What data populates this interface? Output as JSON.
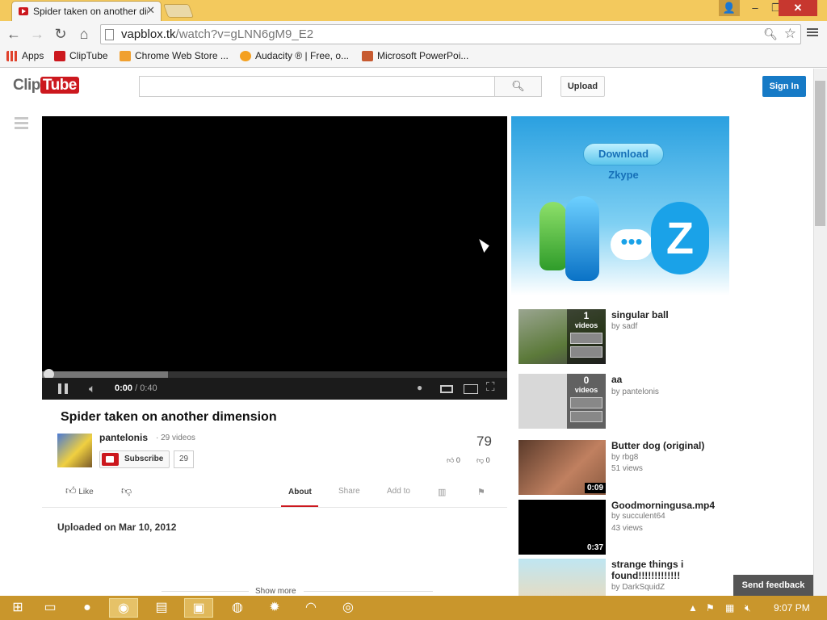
{
  "browser": {
    "tab_title": "Spider taken on another dimension",
    "tab_close": "✕",
    "url_domain": "vapblox.tk",
    "url_path": "/watch?v=gLNN6gM9_E2",
    "bookmarks": [
      {
        "label": "Apps",
        "color": "#e0412b"
      },
      {
        "label": "ClipTube",
        "color": "#cc181e"
      },
      {
        "label": "Chrome Web Store ...",
        "color": "#f0a030"
      },
      {
        "label": "Audacity ® | Free, o...",
        "color": "#f4a020"
      },
      {
        "label": "Microsoft PowerPoi...",
        "color": "#c75a30"
      }
    ],
    "window_buttons": {
      "minimize": "‒",
      "restore": "❐",
      "close": "✕"
    }
  },
  "site": {
    "logo_clip": "Clip",
    "logo_tube": "Tube",
    "upload_label": "Upload",
    "signin_label": "Sign In",
    "search_placeholder": ""
  },
  "player": {
    "current_time": "0:00",
    "duration": "/ 0:40",
    "buffered_fraction": 0.27
  },
  "video": {
    "title": "Spider taken on another dimension",
    "uploader": "pantelonis",
    "video_count": "· 29 videos",
    "subscribe_label": "Subscribe",
    "subscriber_count": "29",
    "views": "79",
    "likes": "0",
    "dislikes": "0",
    "like_label": "Like",
    "tabs": {
      "about": "About",
      "share": "Share",
      "add_to": "Add to"
    },
    "uploaded": "Uploaded on Mar 10, 2012",
    "show_more": "Show more"
  },
  "ad": {
    "button": "Download Zkype",
    "letter": "Z",
    "dots": "•••"
  },
  "related": [
    {
      "title": "singular ball",
      "by": "by sadf",
      "views": "",
      "duration": "",
      "playlist_count": "1",
      "playlist_label": "videos"
    },
    {
      "title": "aa",
      "by": "by pantelonis",
      "views": "",
      "duration": "",
      "playlist_count": "0",
      "playlist_label": "videos"
    },
    {
      "title": "Butter dog (original)",
      "by": "by rbg8",
      "views": "51 views",
      "duration": "0:09"
    },
    {
      "title": "Goodmorningusa.mp4",
      "by": "by succulent64",
      "views": "43 views",
      "duration": "0:37"
    },
    {
      "title": "strange things i found!!!!!!!!!!!!!",
      "by": "by DarkSquidZ",
      "views": "",
      "duration": ""
    }
  ],
  "feedback_label": "Send feedback",
  "taskbar": {
    "clock": "9:07 PM"
  }
}
